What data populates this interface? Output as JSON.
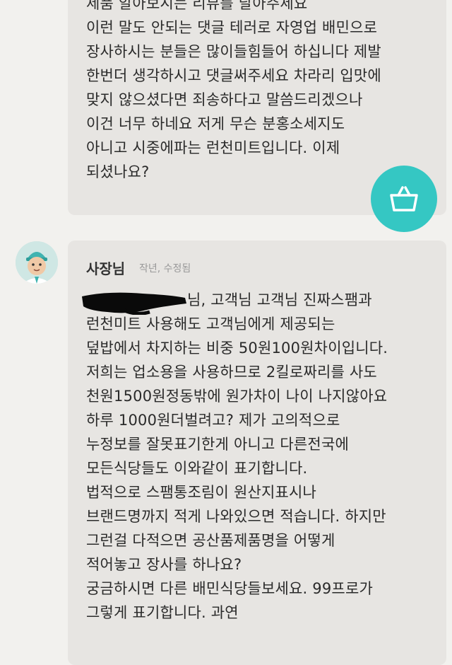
{
  "review_reply_1": {
    "lines": [
      "제품 알아보시는 리뷰를 달아주세요",
      "이런 말도 안되는 댓글 테러로 자영업 배민으로",
      "장사하시는 분들은 많이들힘들어 하십니다 제발",
      "한번더 생각하시고 댓글써주세요 차라리 입맛에",
      "맞지 않으셨다면 죄송하다고 말씀드리겠으나",
      "이건 너무 하네요  저게 무슨 분홍소세지도",
      "아니고 시중에파는 런천미트입니다. 이제",
      "되셨나요?"
    ]
  },
  "cart_button": {
    "icon": "basket-icon",
    "color": "#35c7c3"
  },
  "review_reply_2": {
    "author": "사장님",
    "meta": "작년, 수정됨",
    "lines": [
      "님, 고객님 고객님 진짜스팸과",
      "런천미트 사용해도 고객님에게 제공되는",
      "덮밥에서 차지하는 비중 50원100원차이입니다.",
      "저희는 업소용을 사용하므로 2킬로짜리를 사도",
      "천원1500원정동밖에 원가차이 나이 나지않아요",
      "하루 1000원더벌려고? 제가 고의적으로",
      "누정보를 잘못표기한게 아니고 다른전국에",
      "모든식당들도 이와같이 표기합니다.",
      "법적으로 스팸통조림이 원산지표시나",
      "브랜드명까지 적게 나와있으면 적습니다. 하지만",
      "그런걸 다적으면 공산품제품명을 어떻게",
      "적어놓고 장사를 하나요?",
      "궁금하시면 다른 배민식당들보세요. 99프로가",
      "그렇게 표기합니다. 과연"
    ]
  }
}
